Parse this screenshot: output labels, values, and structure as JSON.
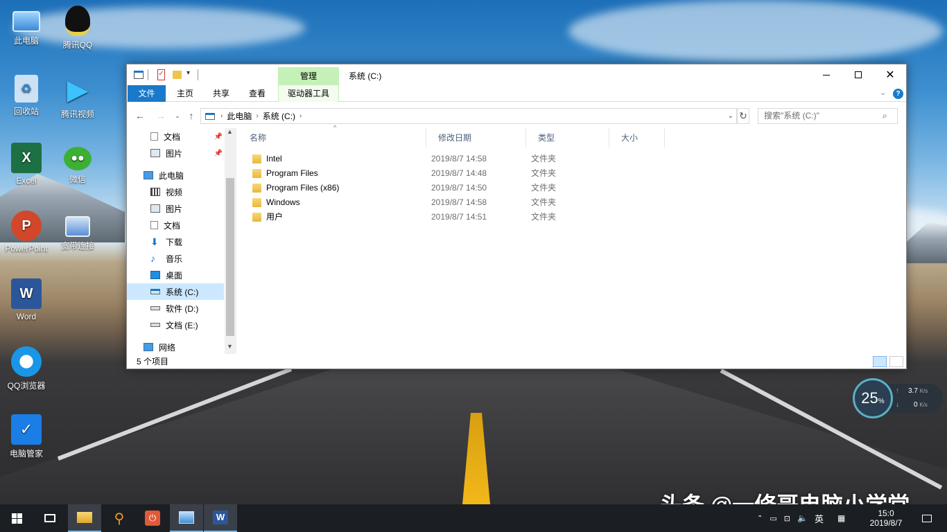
{
  "desktop": {
    "icons": [
      {
        "label": "此电脑",
        "icon": "computer-icon",
        "color": "#4a9be0"
      },
      {
        "label": "腾讯QQ",
        "icon": "qq-icon",
        "color": "#222222"
      },
      {
        "label": "回收站",
        "icon": "recycle-bin-icon",
        "color": "#d7e8f5"
      },
      {
        "label": "腾讯视频",
        "icon": "tencent-video-icon",
        "color": "#2fb0ff"
      },
      {
        "label": "Excel",
        "icon": "excel-icon",
        "color": "#1d7044"
      },
      {
        "label": "微信",
        "icon": "wechat-icon",
        "color": "#3cb034"
      },
      {
        "label": "PowerPoint",
        "icon": "powerpoint-icon",
        "color": "#d2472a"
      },
      {
        "label": "宽带连接",
        "icon": "broadband-icon",
        "color": "#5b8fd6"
      },
      {
        "label": "Word",
        "icon": "word-icon",
        "color": "#2b579a"
      },
      {
        "label": "QQ浏览器",
        "icon": "qq-browser-icon",
        "color": "#1a96e8"
      },
      {
        "label": "电脑管家",
        "icon": "pc-manager-icon",
        "color": "#1a7ee6"
      }
    ],
    "excel_letter": "X",
    "ppt_letter": "P",
    "word_letter": "W"
  },
  "explorer": {
    "context_tab": "管理",
    "title": "系统 (C:)",
    "ribbon_tabs": [
      "文件",
      "主页",
      "共享",
      "查看"
    ],
    "context_ribbon_tab": "驱动器工具",
    "address": {
      "root": "此电脑",
      "current": "系统 (C:)"
    },
    "search_placeholder": "搜索\"系统 (C:)\"",
    "nav": {
      "quick": [
        "文档",
        "图片"
      ],
      "this_pc": "此电脑",
      "pc_items": [
        "视频",
        "图片",
        "文档",
        "下载",
        "音乐",
        "桌面",
        "系统 (C:)",
        "软件 (D:)",
        "文档 (E:)"
      ],
      "network": "网络"
    },
    "columns": [
      "名称",
      "修改日期",
      "类型",
      "大小"
    ],
    "files": [
      {
        "name": "Intel",
        "date": "2019/8/7 14:58",
        "type": "文件夹"
      },
      {
        "name": "Program Files",
        "date": "2019/8/7 14:48",
        "type": "文件夹"
      },
      {
        "name": "Program Files (x86)",
        "date": "2019/8/7 14:50",
        "type": "文件夹"
      },
      {
        "name": "Windows",
        "date": "2019/8/7 14:58",
        "type": "文件夹"
      },
      {
        "name": "用户",
        "date": "2019/8/7 14:51",
        "type": "文件夹"
      }
    ],
    "status": "5 个项目"
  },
  "net_widget": {
    "percent": "25",
    "percent_sign": "%",
    "up": "3.7",
    "down": "0",
    "unit": "K/s"
  },
  "watermark": "头条 @一修哥电脑小学堂",
  "taskbar": {
    "ime": "英",
    "time": "15:0",
    "date": "2019/8/7"
  }
}
